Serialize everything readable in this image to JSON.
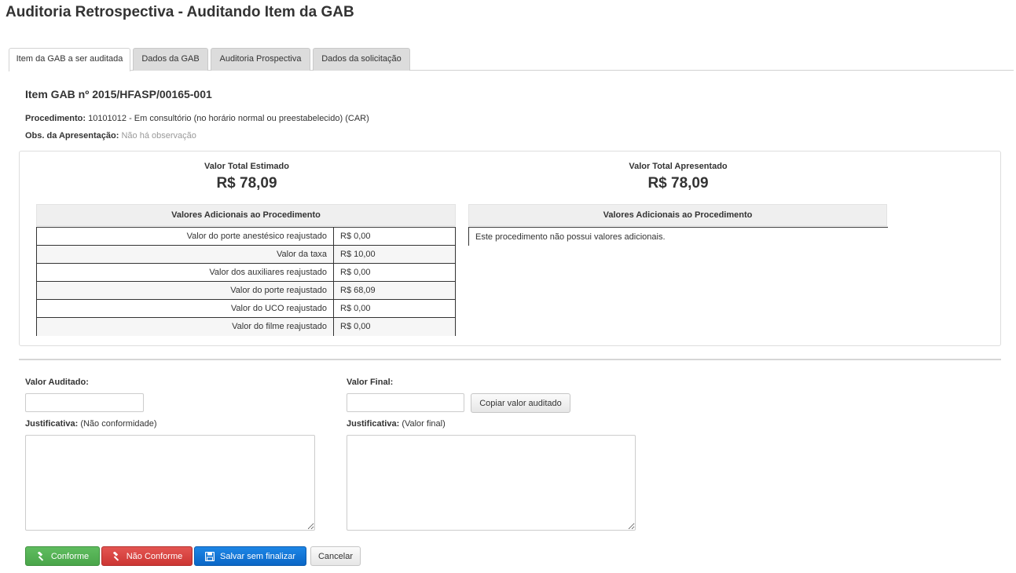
{
  "page": {
    "title": "Auditoria Retrospectiva - Auditando Item da GAB"
  },
  "tabs": [
    {
      "label": "Item da GAB a ser auditada",
      "active": true
    },
    {
      "label": "Dados da GAB",
      "active": false
    },
    {
      "label": "Auditoria Prospectiva",
      "active": false
    },
    {
      "label": "Dados da solicitação",
      "active": false
    }
  ],
  "item": {
    "title": "Item GAB nº 2015/HFASP/00165-001",
    "procedimento_label": "Procedimento:",
    "procedimento_value": "10101012 - Em consultório (no horário normal ou preestabelecido) (CAR)",
    "obs_label": "Obs. da Apresentação:",
    "obs_value": "Não há observação"
  },
  "estimado": {
    "label": "Valor Total Estimado",
    "amount": "R$ 78,09",
    "additional_header": "Valores Adicionais ao Procedimento",
    "rows": [
      {
        "name": "Valor do porte anestésico reajustado",
        "value": "R$ 0,00"
      },
      {
        "name": "Valor da taxa",
        "value": "R$ 10,00"
      },
      {
        "name": "Valor dos auxiliares reajustado",
        "value": "R$ 0,00"
      },
      {
        "name": "Valor do porte reajustado",
        "value": "R$ 68,09"
      },
      {
        "name": "Valor do UCO reajustado",
        "value": "R$ 0,00"
      },
      {
        "name": "Valor do filme reajustado",
        "value": "R$ 0,00"
      }
    ]
  },
  "apresentado": {
    "label": "Valor Total Apresentado",
    "amount": "R$ 78,09",
    "additional_header": "Valores Adicionais ao Procedimento",
    "message": "Este procedimento não possui valores adicionais."
  },
  "form": {
    "valor_auditado_label": "Valor Auditado:",
    "valor_auditado_value": "",
    "valor_final_label": "Valor Final:",
    "valor_final_value": "",
    "copy_button": "Copiar valor auditado",
    "just_label": "Justificativa:",
    "just_left_hint": "(Não conformidade)",
    "just_right_hint": "(Valor final)"
  },
  "actions": {
    "conforme": "Conforme",
    "nao_conforme": "Não Conforme",
    "salvar": "Salvar sem finalizar",
    "cancelar": "Cancelar"
  },
  "colors": {
    "success": "#4cae4c",
    "danger": "#d43f3a",
    "primary": "#0e6fd2"
  }
}
